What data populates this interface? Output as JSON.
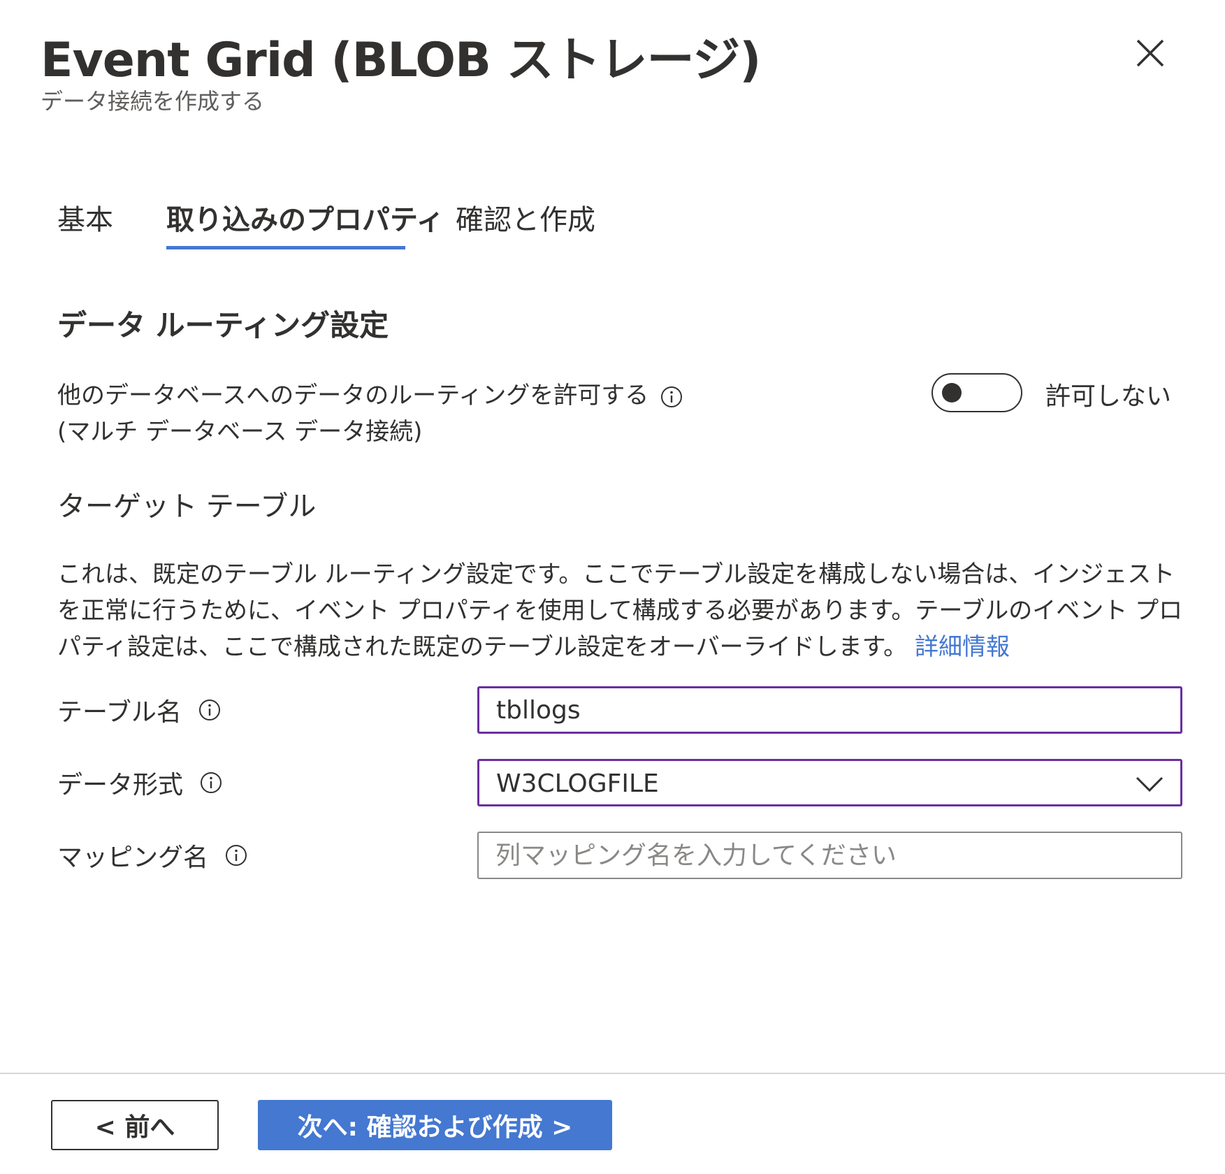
{
  "header": {
    "title": "Event Grid (BLOB ストレージ)",
    "subtitle": "データ接続を作成する"
  },
  "tabs": [
    {
      "label": "基本",
      "active": false
    },
    {
      "label": "取り込みのプロパティ",
      "active": true
    },
    {
      "label": "確認と作成",
      "active": false
    }
  ],
  "routing": {
    "section_title": "データ ルーティング設定",
    "allow_label_line1": "他のデータベースへのデータのルーティングを許可する",
    "allow_label_line2": "(マルチ データベース データ接続)",
    "toggle_on": false,
    "toggle_state_label": "許可しない"
  },
  "target_table": {
    "heading": "ターゲット テーブル",
    "description": "これは、既定のテーブル ルーティング設定です。ここでテーブル設定を構成しない場合は、インジェストを正常に行うために、イベント プロパティを使用して構成する必要があります。テーブルのイベント プロパティ設定は、ここで構成された既定のテーブル設定をオーバーライドします。",
    "learn_more_link": "詳細情報"
  },
  "fields": {
    "table_name_label": "テーブル名",
    "table_name_value": "tbllogs",
    "data_format_label": "データ形式",
    "data_format_value": "W3CLOGFILE",
    "mapping_name_label": "マッピング名",
    "mapping_name_value": "",
    "mapping_name_placeholder": "列マッピング名を入力してください"
  },
  "footer": {
    "prev_label": "< 前へ",
    "next_label": "次へ: 確認および作成 >"
  },
  "colors": {
    "accent": "#4478d1",
    "focus_border": "#6b2fa0",
    "text": "#323130",
    "subtle_text": "#605e5c"
  }
}
